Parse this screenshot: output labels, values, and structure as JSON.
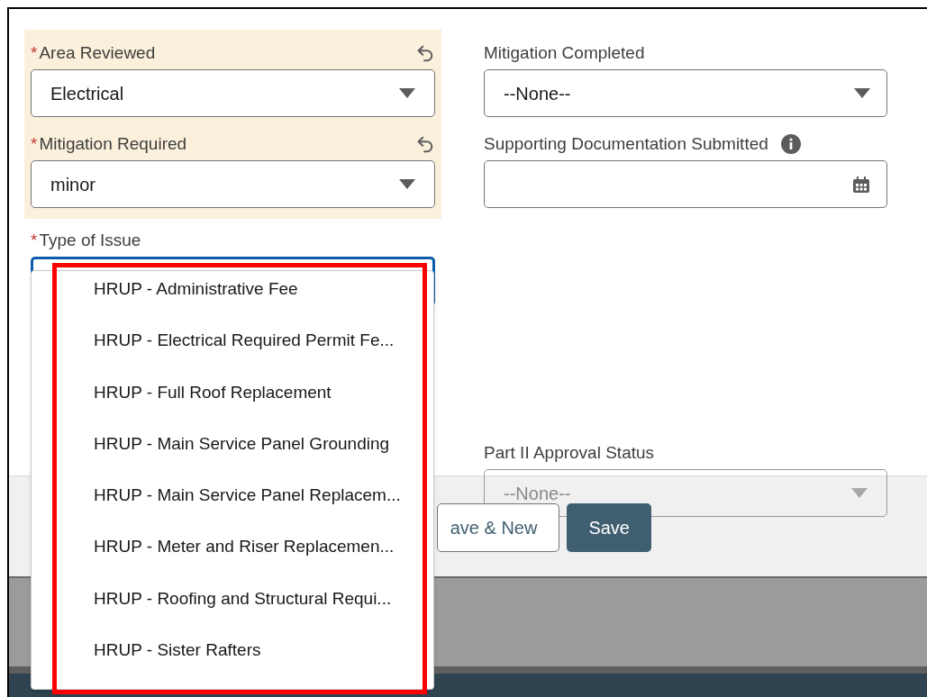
{
  "left_fields": [
    {
      "label": "Area Reviewed",
      "required_mark": "*",
      "edited": true,
      "value": "Electrical"
    },
    {
      "label": "Mitigation Required",
      "required_mark": "*",
      "edited": true,
      "value": "minor"
    }
  ],
  "right_fields": [
    {
      "label": "Mitigation Completed",
      "kind": "select",
      "value": "--None--"
    },
    {
      "label": "Supporting Documentation Submitted",
      "kind": "date",
      "info": true
    }
  ],
  "type_of_issue": {
    "label": "Type of Issue",
    "required_mark": "*",
    "focused": true,
    "options": [
      {
        "label": "HRUP - Administrative Fee"
      },
      {
        "label": "HRUP - Electrical Required Permit Fe..."
      },
      {
        "label": "HRUP - Full Roof Replacement"
      },
      {
        "label": "HRUP - Main Service Panel Grounding"
      },
      {
        "label": "HRUP - Main Service Panel Replacem..."
      },
      {
        "label": "HRUP - Meter and Riser Replacemen..."
      },
      {
        "label": "HRUP - Roofing and Structural Requi..."
      },
      {
        "label": "HRUP - Sister Rafters"
      }
    ]
  },
  "part2": {
    "label": "Part II Approval Status",
    "value": "--None--"
  },
  "buttons": [
    {
      "label": "ave & New",
      "kind": "neutral"
    },
    {
      "label": "Save",
      "kind": "brand"
    }
  ]
}
